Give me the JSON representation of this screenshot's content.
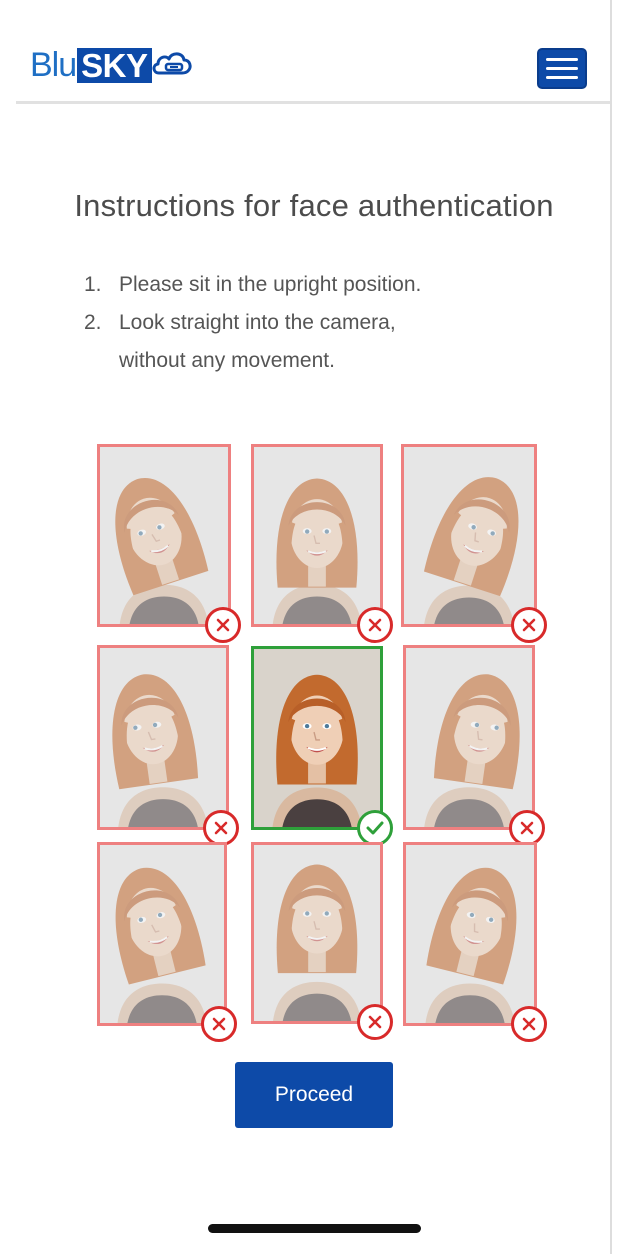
{
  "header": {
    "logo": {
      "part1": "Blu",
      "part2": "SKY",
      "icon": "cloud-icon"
    },
    "menu": {
      "icon": "hamburger-menu-icon"
    }
  },
  "page": {
    "title": "Instructions for face authentication",
    "instructions": [
      {
        "num": "1.",
        "lines": [
          "Please sit in the upright position."
        ]
      },
      {
        "num": "2.",
        "lines": [
          "Look straight into the camera,",
          "without any movement."
        ]
      }
    ]
  },
  "examples": [
    {
      "pose": "tilted-left-looking-down",
      "status": "incorrect"
    },
    {
      "pose": "looking-down",
      "status": "incorrect"
    },
    {
      "pose": "tilted-right-looking-down",
      "status": "incorrect"
    },
    {
      "pose": "turned-left",
      "status": "incorrect"
    },
    {
      "pose": "facing-straight",
      "status": "correct"
    },
    {
      "pose": "turned-right",
      "status": "incorrect"
    },
    {
      "pose": "tilted-left-looking-up",
      "status": "incorrect"
    },
    {
      "pose": "looking-up",
      "status": "incorrect"
    },
    {
      "pose": "tilted-right-looking-up",
      "status": "incorrect"
    }
  ],
  "status_icons": {
    "incorrect": "x-circle-icon",
    "correct": "check-circle-icon"
  },
  "colors": {
    "brand_blue": "#0d4aa8",
    "incorrect_border": "#ee8080",
    "incorrect_badge": "#d82a2a",
    "correct": "#2ea03a"
  },
  "actions": {
    "proceed_label": "Proceed"
  }
}
